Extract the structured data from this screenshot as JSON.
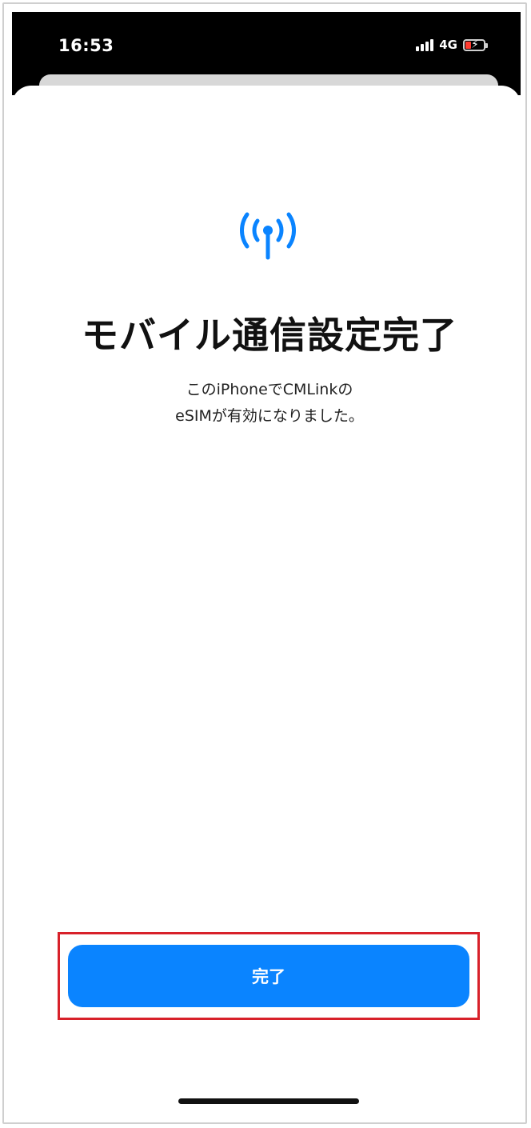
{
  "status_bar": {
    "time": "16:53",
    "network": "4G",
    "icons": [
      "signal-bars-icon",
      "battery-charging-icon"
    ]
  },
  "sheet": {
    "icon": "cellular-antenna-icon",
    "title": "モバイル通信設定完了",
    "message_line1": "このiPhoneでCMLinkの",
    "message_line2": "eSIMが有効になりました。",
    "done_label": "完了"
  },
  "colors": {
    "accent": "#0A84FF",
    "highlight": "#D8212A",
    "battery_low": "#FF3B30"
  }
}
